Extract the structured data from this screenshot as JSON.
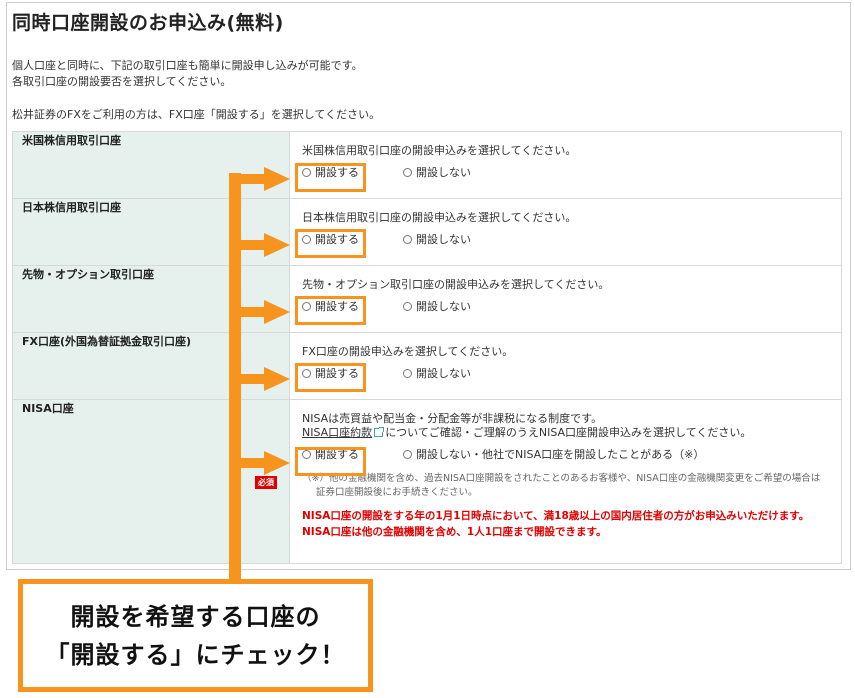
{
  "title": "同時口座開設のお申込み(無料)",
  "intro": {
    "line1": "個人口座と同時に、下記の取引口座も簡単に開設申し込みが可能です。",
    "line2": "各取引口座の開設要否を選択してください。",
    "line3": "松井証券のFXをご利用の方は、FX口座「開設する」を選択してください。"
  },
  "rows": [
    {
      "label": "米国株信用取引口座",
      "desc": "米国株信用取引口座の開設申込みを選択してください。",
      "yes": "開設する",
      "no": "開設しない"
    },
    {
      "label": "日本株信用取引口座",
      "desc": "日本株信用取引口座の開設申込みを選択してください。",
      "yes": "開設する",
      "no": "開設しない"
    },
    {
      "label": "先物・オプション取引口座",
      "desc": "先物・オプション取引口座の開設申込みを選択してください。",
      "yes": "開設する",
      "no": "開設しない"
    },
    {
      "label": "FX口座(外国為替証拠金取引口座)",
      "desc": "FX口座の開設申込みを選択してください。",
      "yes": "開設する",
      "no": "開設しない"
    }
  ],
  "nisa": {
    "label": "NISA口座",
    "required": "必須",
    "desc1": "NISAは売買益や配当金・分配金等が非課税になる制度です。",
    "link": "NISA口座約款",
    "desc2": "についてご確認・ご理解のうえNISA口座開設申込みを選択してください。",
    "yes": "開設する",
    "no": "開設しない・他社でNISA口座を開設したことがある（※）",
    "note": "（※）他の金融機関を含め、過去NISA口座開設をされたことのあるお客様や、NISA口座の金融機関変更をご希望の場合は証券口座開設後にお手続きください。",
    "warn1": "NISA口座の開設をする年の1月1日時点において、満18歳以上の国内居住者の方がお申込みいただけます。",
    "warn2": "NISA口座は他の金融機関を含め、1人1口座まで開設できます。"
  },
  "callout": {
    "line1": "開設を希望する口座の",
    "line2": "「開設する」にチェック！"
  },
  "colors": {
    "accent": "#f7941d",
    "labelBg": "#e6f0ec",
    "warn": "#e00000"
  }
}
